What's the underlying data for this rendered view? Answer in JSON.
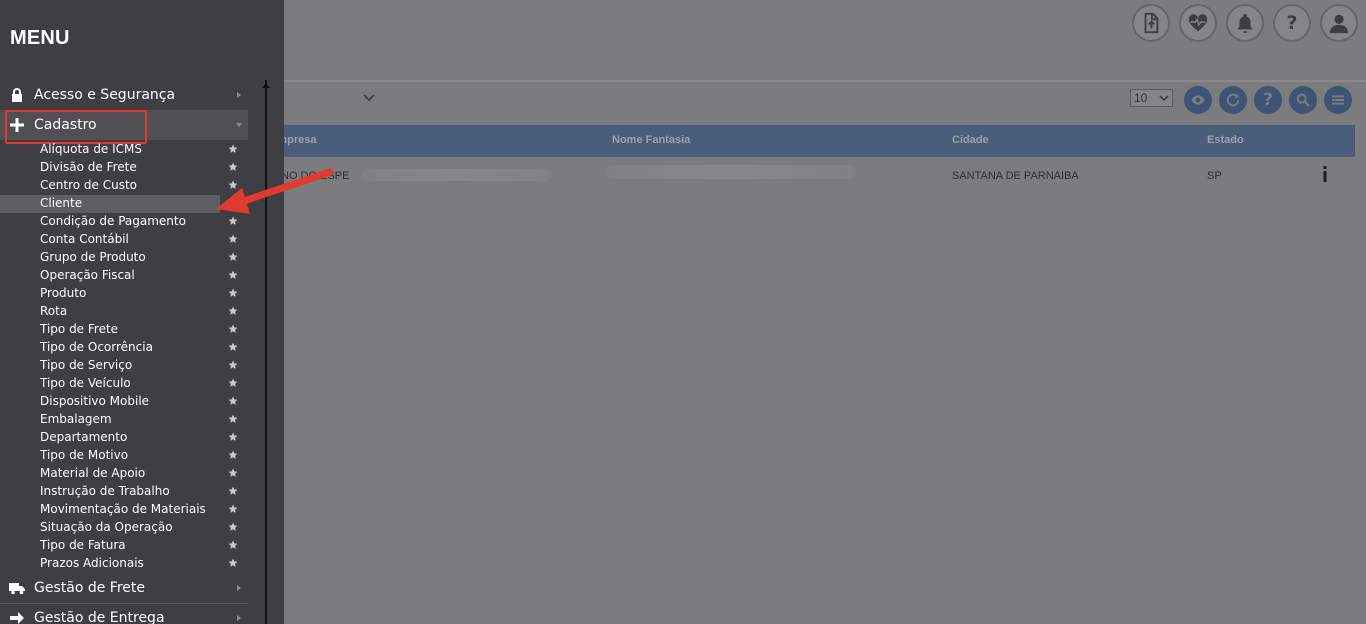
{
  "sidebar": {
    "title": "MENU",
    "sections": [
      {
        "label": "Acesso e Segurança",
        "icon": "lock-icon"
      },
      {
        "label": "Cadastro",
        "icon": "plus-icon"
      },
      {
        "label": "Gestão de Frete",
        "icon": "truck-icon"
      },
      {
        "label": "Gestão de Entrega",
        "icon": "arrow-right-icon"
      }
    ],
    "cadastro_items": [
      "Alíquota de ICMS",
      "Divisão de Frete",
      "Centro de Custo",
      "Cliente",
      "Condição de Pagamento",
      "Conta Contábil",
      "Grupo de Produto",
      "Operação Fiscal",
      "Produto",
      "Rota",
      "Tipo de Frete",
      "Tipo de Ocorrência",
      "Tipo de Serviço",
      "Tipo de Veículo",
      "Dispositivo Mobile",
      "Embalagem",
      "Departamento",
      "Tipo de Motivo",
      "Material de Apoio",
      "Instrução de Trabalho",
      "Movimentação de Materiais",
      "Situação da Operação",
      "Tipo de Fatura",
      "Prazos Adicionais"
    ],
    "selected_item": "Cliente"
  },
  "toolbar": {
    "page_size": "10",
    "top_icons": [
      "upload-file-icon",
      "heart-pulse-icon",
      "bell-icon",
      "help-icon",
      "user-icon"
    ],
    "tool_icons": [
      "eye-icon",
      "refresh-icon",
      "help-icon",
      "search-icon",
      "menu-icon"
    ]
  },
  "table": {
    "columns": [
      "Empresa",
      "Nome Fantasia",
      "Cidade",
      "Estado"
    ],
    "rows": [
      {
        "empresa": "C NO DO ESPE",
        "nome_fantasia": "",
        "cidade": "SANTANA DE PARNAIBA",
        "estado": "SP"
      }
    ]
  },
  "colors": {
    "sidebar_bg": "#3f3e42",
    "overlay_bg": "#7c7b7d",
    "table_header": "#4a5d7a",
    "highlight_red": "#e23a31"
  }
}
